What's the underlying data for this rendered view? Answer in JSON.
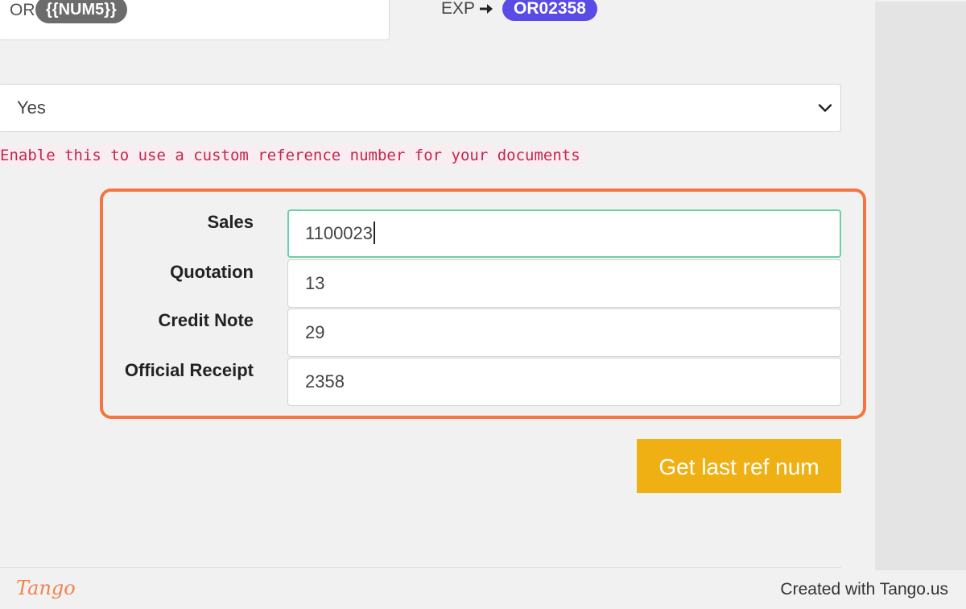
{
  "format_field": {
    "prefix": "OR",
    "token": "{{NUM5}}"
  },
  "example": {
    "label": "EXP",
    "arrow_icon": "arrow-right-icon",
    "value": "OR02358"
  },
  "custom_ref_select": {
    "selected": "Yes",
    "chevron_icon": "chevron-down-icon",
    "hint": "Enable this to use a custom reference number for your documents"
  },
  "ref_numbers": {
    "sales": {
      "label": "Sales",
      "value": "1100023"
    },
    "quotation": {
      "label": "Quotation",
      "value": "13"
    },
    "credit_note": {
      "label": "Credit Note",
      "value": "29"
    },
    "official_receipt": {
      "label": "Official Receipt",
      "value": "2358"
    }
  },
  "actions": {
    "get_last_ref_num": "Get last ref num"
  },
  "footer": {
    "logo": "Tango",
    "credit": "Created with Tango.us"
  },
  "colors": {
    "highlight": "#f37640",
    "button": "#efb014",
    "badge_example": "#5a4be6",
    "badge_token": "#6c6c6c",
    "hint_text": "#c7254e",
    "focus_border": "#6cd0a4"
  }
}
